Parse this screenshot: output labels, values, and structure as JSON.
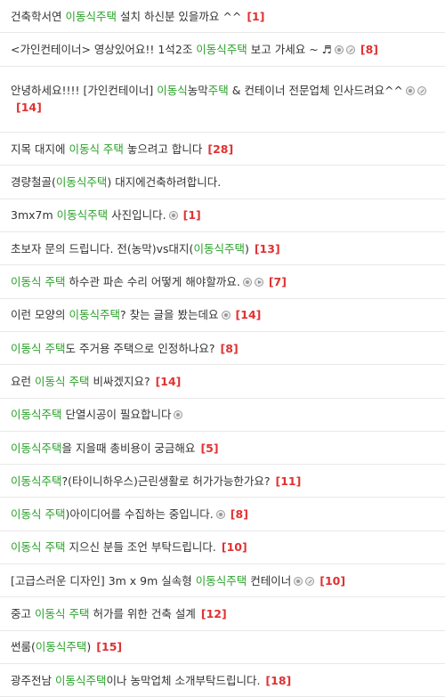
{
  "colors": {
    "highlight": "#2aa12a",
    "count": "#e03131",
    "text": "#333333",
    "divider": "#e8e8e8"
  },
  "posts": [
    {
      "segments": [
        {
          "t": "건축학서연 "
        },
        {
          "t": "이동식주택",
          "h": true
        },
        {
          "t": " 설치 하신분 있을까요 ^^"
        }
      ],
      "icons": [],
      "count": "[1]"
    },
    {
      "segments": [
        {
          "t": "<가인컨테이너> 영상있어요!! 1석2조 "
        },
        {
          "t": "이동식주택",
          "h": true
        },
        {
          "t": " 보고 가세요 ~ ♬"
        }
      ],
      "icons": [
        "image-icon",
        "attach-icon"
      ],
      "count": "[8]"
    },
    {
      "double": true,
      "segments": [
        {
          "t": "안녕하세요!!!! [가인컨테이너] "
        },
        {
          "t": "이동식",
          "h": true
        },
        {
          "t": "농막"
        },
        {
          "t": "주택",
          "h": true
        },
        {
          "t": " & 컨테이너 전문업체 인사드려요^^"
        }
      ],
      "icons": [
        "image-icon",
        "attach-icon"
      ],
      "count": "[14]"
    },
    {
      "segments": [
        {
          "t": "지목 대지에 "
        },
        {
          "t": "이동식 주택",
          "h": true
        },
        {
          "t": " 놓으려고 합니다"
        }
      ],
      "icons": [],
      "count": "[28]"
    },
    {
      "segments": [
        {
          "t": "경량철골("
        },
        {
          "t": "이동식주택",
          "h": true
        },
        {
          "t": ") 대지에건축하려합니다."
        }
      ],
      "icons": [],
      "count": ""
    },
    {
      "segments": [
        {
          "t": "3mx7m "
        },
        {
          "t": "이동식주택",
          "h": true
        },
        {
          "t": " 사진입니다."
        }
      ],
      "icons": [
        "image-icon"
      ],
      "count": "[1]"
    },
    {
      "segments": [
        {
          "t": "초보자 문의 드립니다. 전(농막)vs대지("
        },
        {
          "t": "이동식주택",
          "h": true
        },
        {
          "t": ")"
        }
      ],
      "icons": [],
      "count": "[13]"
    },
    {
      "segments": [
        {
          "t": "이동식 주택",
          "h": true
        },
        {
          "t": " 하수관 파손 수리 어떻게 해야할까요."
        }
      ],
      "icons": [
        "image-icon",
        "video-icon"
      ],
      "count": "[7]"
    },
    {
      "segments": [
        {
          "t": "이런 모양의 "
        },
        {
          "t": "이동식주택",
          "h": true
        },
        {
          "t": "? 찾는 글을 봤는데요"
        }
      ],
      "icons": [
        "image-icon"
      ],
      "count": "[14]"
    },
    {
      "segments": [
        {
          "t": "이동식 주택",
          "h": true
        },
        {
          "t": "도 주거용 주택으로 인정하나요?"
        }
      ],
      "icons": [],
      "count": "[8]"
    },
    {
      "segments": [
        {
          "t": "요런 "
        },
        {
          "t": "이동식 주택",
          "h": true
        },
        {
          "t": " 비싸겠지요?"
        }
      ],
      "icons": [],
      "count": "[14]"
    },
    {
      "segments": [
        {
          "t": "이동식주택",
          "h": true
        },
        {
          "t": " 단열시공이 필요합니다"
        }
      ],
      "icons": [
        "image-icon"
      ],
      "count": ""
    },
    {
      "segments": [
        {
          "t": "이동식주택",
          "h": true
        },
        {
          "t": "을 지을때 총비용이 궁금해요"
        }
      ],
      "icons": [],
      "count": "[5]"
    },
    {
      "segments": [
        {
          "t": "이동식주택",
          "h": true
        },
        {
          "t": "?(타이니하우스)근린생활로 허가가능한가요?"
        }
      ],
      "icons": [],
      "count": "[11]"
    },
    {
      "segments": [
        {
          "t": "이동식 주택",
          "h": true
        },
        {
          "t": ")아이디어를 수집하는 중입니다."
        }
      ],
      "icons": [
        "image-icon"
      ],
      "count": "[8]"
    },
    {
      "segments": [
        {
          "t": "이동식 주택",
          "h": true
        },
        {
          "t": " 지으신 분들 조언 부탁드립니다."
        }
      ],
      "icons": [],
      "count": "[10]"
    },
    {
      "segments": [
        {
          "t": "[고급스러운 디자인] 3m x 9m 실속형 "
        },
        {
          "t": "이동식주택",
          "h": true
        },
        {
          "t": " 컨테이너"
        }
      ],
      "icons": [
        "image-icon",
        "attach-icon"
      ],
      "count": "[10]"
    },
    {
      "segments": [
        {
          "t": "중고 "
        },
        {
          "t": "이동식 주택",
          "h": true
        },
        {
          "t": " 허가를 위한 건축 설계"
        }
      ],
      "icons": [],
      "count": "[12]"
    },
    {
      "segments": [
        {
          "t": "썬룸("
        },
        {
          "t": "이동식주택",
          "h": true
        },
        {
          "t": ")"
        }
      ],
      "icons": [],
      "count": "[15]"
    },
    {
      "segments": [
        {
          "t": "광주전남 "
        },
        {
          "t": "이동식주택",
          "h": true
        },
        {
          "t": "이나 농막업체 소개부탁드립니다."
        }
      ],
      "icons": [],
      "count": "[18]"
    }
  ]
}
